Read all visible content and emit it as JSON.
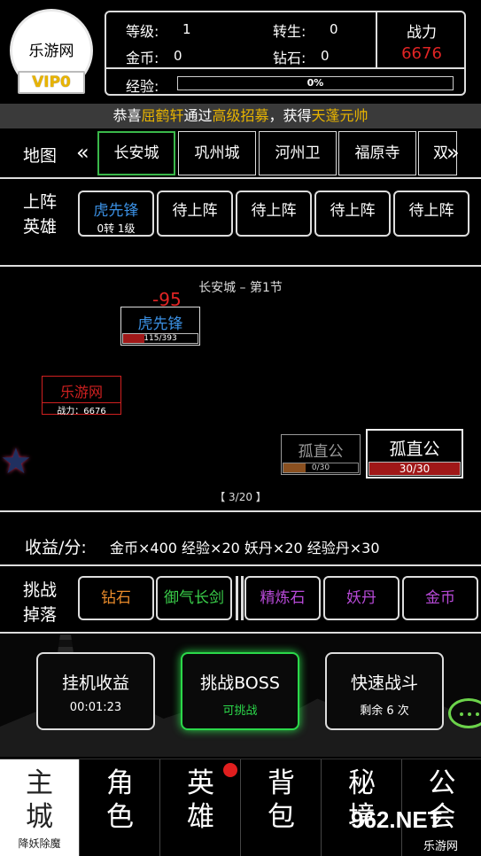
{
  "header": {
    "avatar_name": "乐游网",
    "vip_label": "VIP0",
    "level_label": "等级:",
    "level_value": "1",
    "rebirth_label": "转生:",
    "rebirth_value": "0",
    "gold_label": "金币:",
    "gold_value": "0",
    "diamond_label": "钻石:",
    "diamond_value": "0",
    "power_label": "战力",
    "power_value": "6676",
    "exp_label": "经验:",
    "exp_text": "0%",
    "exp_progress": 0.0
  },
  "marquee": {
    "prefix": "恭喜",
    "player": "屈鹤轩",
    "middle": "通过",
    "method": "高级招募",
    "middle2": "，获得",
    "reward": "天蓬元帅"
  },
  "map": {
    "label": "地图",
    "prev_icon": "«",
    "next_icon": "»",
    "tabs": [
      "长安城",
      "巩州城",
      "河州卫",
      "福原寺",
      "双"
    ]
  },
  "heroes": {
    "label_line1": "上阵",
    "label_line2": "英雄",
    "slots": [
      {
        "name": "虎先锋",
        "sub": "0转 1级"
      },
      {
        "name": "待上阵"
      },
      {
        "name": "待上阵"
      },
      {
        "name": "待上阵"
      },
      {
        "name": "待上阵"
      }
    ]
  },
  "battle": {
    "stage": "长安城 – 第1节",
    "damage": "-95",
    "ally": {
      "name": "虎先锋",
      "hp_text": "115/393",
      "hp_frac": 0.29
    },
    "player": {
      "name": "乐游网",
      "power_text": "战力：6676"
    },
    "enemy_dim": {
      "name": "孤直公",
      "hp_text": "0/30",
      "hp_frac": 0.0
    },
    "enemy": {
      "name": "孤直公",
      "hp_text": "30/30",
      "hp_frac": 1.0
    },
    "page": "【 3/20 】"
  },
  "income": {
    "label": "收益/分:",
    "items": "金币×400  经验×20  妖丹×20  经验丹×30"
  },
  "drops": {
    "label_line1": "挑战",
    "label_line2": "掉落",
    "items": [
      {
        "name": "钻石",
        "color": "#e88a2a"
      },
      {
        "name": "御气长剑",
        "color": "#3ad04a"
      },
      {
        "name": "精炼石",
        "color": "#b84ad8"
      },
      {
        "name": "妖丹",
        "color": "#b84ad8"
      },
      {
        "name": "金币",
        "color": "#b84ad8"
      }
    ]
  },
  "actions": {
    "idle": {
      "title": "挂机收益",
      "sub": "00:01:23"
    },
    "boss": {
      "title": "挑战BOSS",
      "sub": "可挑战"
    },
    "quick": {
      "title": "快速战斗",
      "sub": "剩余 6 次"
    }
  },
  "nav": {
    "items": [
      {
        "line1": "主",
        "line2": "城",
        "sub": "降妖除魔"
      },
      {
        "line1": "角",
        "line2": "色"
      },
      {
        "line1": "英",
        "line2": "雄"
      },
      {
        "line1": "背",
        "line2": "包"
      },
      {
        "line1": "秘",
        "line2": "境"
      },
      {
        "line1": "公",
        "line2": "会"
      }
    ]
  },
  "watermark": {
    "main": "962.NET",
    "sub": "乐游网"
  }
}
